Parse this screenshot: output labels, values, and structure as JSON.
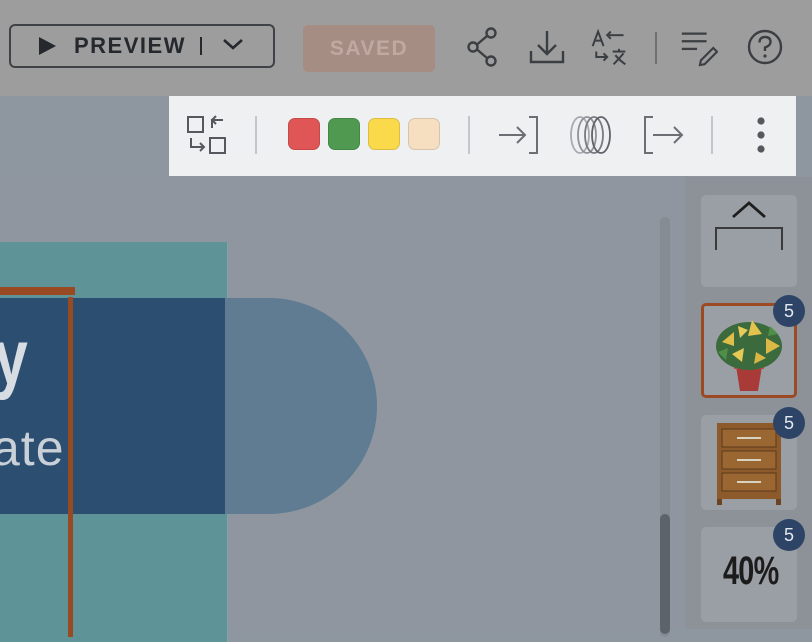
{
  "toolbar": {
    "preview_label": "PREVIEW",
    "saved_label": "SAVED",
    "icons": [
      "play-icon",
      "chevron-down-icon",
      "share-icon",
      "download-icon",
      "translate-icon",
      "edit-notes-icon",
      "help-icon"
    ]
  },
  "format_bar": {
    "icons": [
      "arrange-icon",
      "enter-icon",
      "motion-blur-icon",
      "exit-icon",
      "more-vertical-icon"
    ],
    "colors": [
      "#e05555",
      "#4f9a50",
      "#fad94b",
      "#f6dfc1"
    ]
  },
  "canvas": {
    "title_fragment": "y",
    "subtitle_fragment": "ate"
  },
  "thumbnails": [
    {
      "kind": "scroll-up",
      "badge": ""
    },
    {
      "kind": "plant",
      "badge": "5",
      "selected": true
    },
    {
      "kind": "drawers",
      "badge": "5"
    },
    {
      "kind": "percent",
      "badge": "5",
      "text": "40%"
    }
  ]
}
